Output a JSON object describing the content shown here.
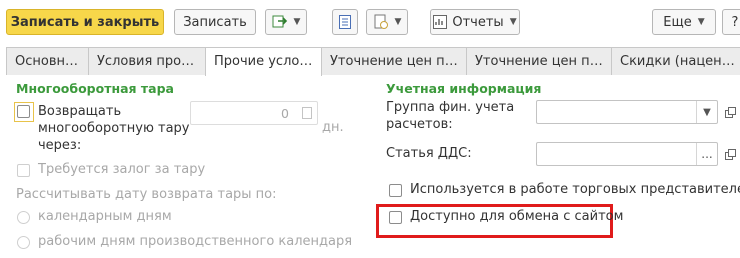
{
  "toolbar": {
    "save_close_label": "Записать и закрыть",
    "save_label": "Записать",
    "reports_label": "Отчеты",
    "more_label": "Еще",
    "help_label": "?"
  },
  "tabs": [
    {
      "label": "Основное"
    },
    {
      "label": "Условия продаж"
    },
    {
      "label": "Прочие условия"
    },
    {
      "label": "Уточнение цен по ..."
    },
    {
      "label": "Уточнение цен по ..."
    },
    {
      "label": "Скидки (наценки)"
    }
  ],
  "left": {
    "section_title": "Многооборотная тара",
    "return_label_line1": "Возвращать",
    "return_label_line2": "многооборотную тару",
    "return_label_line3": "через:",
    "days_value": "0",
    "days_unit": "дн.",
    "deposit_label": "Требуется залог за тару",
    "calc_label": "Рассчитывать дату возврата тары по:",
    "radio_calendar": "календарным дням",
    "radio_work": "рабочим дням производственного календаря"
  },
  "right": {
    "section_title": "Учетная информация",
    "fin_group_label_line1": "Группа фин. учета",
    "fin_group_label_line2": "расчетов:",
    "fin_group_value": "",
    "dds_label": "Статья ДДС:",
    "dds_value": "",
    "sales_reps_label": "Используется в работе торговых представителей",
    "site_exchange_label": "Доступно для обмена с сайтом"
  },
  "colors": {
    "primary_button": "#f7d74a",
    "section_title": "#3c9a3c",
    "highlight": "#e01b1b"
  }
}
